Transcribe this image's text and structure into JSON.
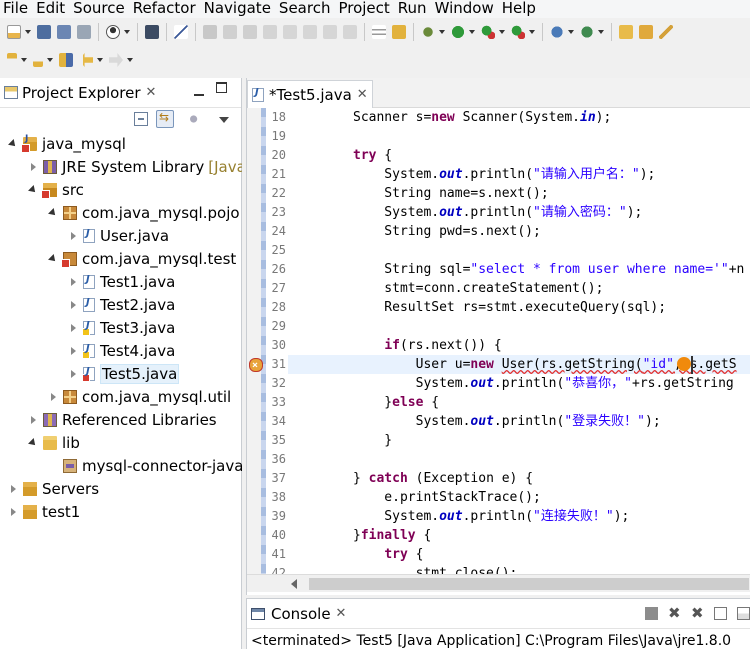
{
  "menu": [
    "File",
    "Edit",
    "Source",
    "Refactor",
    "Navigate",
    "Search",
    "Project",
    "Run",
    "Window",
    "Help"
  ],
  "explorer": {
    "title": "Project Explorer",
    "tree": [
      {
        "label": "java_mysql",
        "indent": 0,
        "state": "open",
        "icon": "project-error-icon",
        "name": "tree-project-java-mysql"
      },
      {
        "label": "JRE System Library",
        "suffix": "[Java",
        "indent": 1,
        "state": "closed",
        "icon": "library-icon",
        "name": "tree-jre-system-library"
      },
      {
        "label": "src",
        "indent": 1,
        "state": "open",
        "icon": "source-folder-error-icon",
        "name": "tree-src"
      },
      {
        "label": "com.java_mysql.pojo",
        "indent": 2,
        "state": "open",
        "icon": "package-icon",
        "name": "tree-package-pojo"
      },
      {
        "label": "User.java",
        "indent": 3,
        "state": "closed",
        "icon": "java-file-icon",
        "name": "tree-user-java"
      },
      {
        "label": "com.java_mysql.test",
        "indent": 2,
        "state": "open",
        "icon": "package-error-icon",
        "name": "tree-package-test"
      },
      {
        "label": "Test1.java",
        "indent": 3,
        "state": "closed",
        "icon": "java-file-icon",
        "name": "tree-test1-java"
      },
      {
        "label": "Test2.java",
        "indent": 3,
        "state": "closed",
        "icon": "java-file-icon",
        "name": "tree-test2-java"
      },
      {
        "label": "Test3.java",
        "indent": 3,
        "state": "closed",
        "icon": "java-file-warning-icon",
        "name": "tree-test3-java"
      },
      {
        "label": "Test4.java",
        "indent": 3,
        "state": "closed",
        "icon": "java-file-warning-icon",
        "name": "tree-test4-java"
      },
      {
        "label": "Test5.java",
        "indent": 3,
        "state": "closed",
        "icon": "java-file-error-icon",
        "name": "tree-test5-java",
        "selected": true
      },
      {
        "label": "com.java_mysql.util",
        "indent": 2,
        "state": "closed",
        "icon": "package-icon",
        "name": "tree-package-util"
      },
      {
        "label": "Referenced Libraries",
        "indent": 1,
        "state": "closed",
        "icon": "referenced-libraries-icon",
        "name": "tree-referenced-libraries"
      },
      {
        "label": "lib",
        "indent": 1,
        "state": "open",
        "icon": "folder-icon",
        "name": "tree-lib"
      },
      {
        "label": "mysql-connector-java",
        "indent": 2,
        "state": "none",
        "icon": "jar-file-icon",
        "name": "tree-mysql-connector"
      },
      {
        "label": "Servers",
        "indent": 0,
        "state": "closed",
        "icon": "project-icon",
        "name": "tree-servers"
      },
      {
        "label": "test1",
        "indent": 0,
        "state": "closed",
        "icon": "project-icon",
        "name": "tree-test1-project"
      }
    ]
  },
  "editor": {
    "tab_title": "*Test5.java",
    "current_line": 31,
    "error_line": 31,
    "lines": [
      {
        "no": "18",
        "tokens": [
          [
            "",
            "Scanner s="
          ],
          [
            "kw",
            "new"
          ],
          [
            "",
            " Scanner(System."
          ],
          [
            "fld",
            "in"
          ],
          [
            "",
            ");"
          ]
        ]
      },
      {
        "no": "19",
        "tokens": []
      },
      {
        "no": "20",
        "tokens": [
          [
            "kw",
            "try"
          ],
          [
            "",
            " {"
          ]
        ]
      },
      {
        "no": "21",
        "tokens": [
          [
            "",
            "    System."
          ],
          [
            "fld",
            "out"
          ],
          [
            "",
            ".println("
          ],
          [
            "str",
            "\"请输入用户名：\""
          ],
          [
            "",
            ");"
          ]
        ]
      },
      {
        "no": "22",
        "tokens": [
          [
            "",
            "    String name=s.next();"
          ]
        ]
      },
      {
        "no": "23",
        "tokens": [
          [
            "",
            "    System."
          ],
          [
            "fld",
            "out"
          ],
          [
            "",
            ".println("
          ],
          [
            "str",
            "\"请输入密码：\""
          ],
          [
            "",
            ");"
          ]
        ]
      },
      {
        "no": "24",
        "tokens": [
          [
            "",
            "    String pwd=s.next();"
          ]
        ]
      },
      {
        "no": "25",
        "tokens": []
      },
      {
        "no": "26",
        "tokens": [
          [
            "",
            "    String sql="
          ],
          [
            "str",
            "\"select * from user where name='\""
          ],
          [
            "",
            "+n"
          ]
        ]
      },
      {
        "no": "27",
        "tokens": [
          [
            "",
            "    stmt=conn.createStatement();"
          ]
        ]
      },
      {
        "no": "28",
        "tokens": [
          [
            "",
            "    ResultSet rs=stmt.executeQuery(sql);"
          ]
        ]
      },
      {
        "no": "29",
        "tokens": []
      },
      {
        "no": "30",
        "tokens": [
          [
            "",
            "    "
          ],
          [
            "kw",
            "if"
          ],
          [
            "",
            "(rs.next()) {"
          ]
        ]
      },
      {
        "no": "31",
        "tokens": [
          [
            "",
            "        User u="
          ],
          [
            "kw",
            "new"
          ],
          [
            "",
            " "
          ],
          [
            "err",
            "User(rs.getString("
          ],
          [
            "str err",
            "\"id\""
          ],
          [
            "err",
            ",rs.getS"
          ]
        ]
      },
      {
        "no": "32",
        "tokens": [
          [
            "",
            "        System."
          ],
          [
            "fld",
            "out"
          ],
          [
            "",
            ".println("
          ],
          [
            "str",
            "\"恭喜你，\""
          ],
          [
            "",
            "+rs.getString"
          ]
        ]
      },
      {
        "no": "33",
        "tokens": [
          [
            "",
            "    }"
          ],
          [
            "kw",
            "else"
          ],
          [
            "",
            " {"
          ]
        ]
      },
      {
        "no": "34",
        "tokens": [
          [
            "",
            "        System."
          ],
          [
            "fld",
            "out"
          ],
          [
            "",
            ".println("
          ],
          [
            "str",
            "\"登录失败！\""
          ],
          [
            "",
            ");"
          ]
        ]
      },
      {
        "no": "35",
        "tokens": [
          [
            "",
            "    }"
          ]
        ]
      },
      {
        "no": "36",
        "tokens": []
      },
      {
        "no": "37",
        "tokens": [
          [
            "",
            "} "
          ],
          [
            "kw",
            "catch"
          ],
          [
            "",
            " (Exception e) {"
          ]
        ]
      },
      {
        "no": "38",
        "tokens": [
          [
            "",
            "    e.printStackTrace();"
          ]
        ]
      },
      {
        "no": "39",
        "tokens": [
          [
            "",
            "    System."
          ],
          [
            "fld",
            "out"
          ],
          [
            "",
            ".println("
          ],
          [
            "str",
            "\"连接失败！\""
          ],
          [
            "",
            ");"
          ]
        ]
      },
      {
        "no": "40",
        "tokens": [
          [
            "",
            "}"
          ],
          [
            "kw",
            "finally"
          ],
          [
            "",
            " {"
          ]
        ]
      },
      {
        "no": "41",
        "tokens": [
          [
            "",
            "    "
          ],
          [
            "kw",
            "try"
          ],
          [
            "",
            " {"
          ]
        ]
      },
      {
        "no": "42",
        "tokens": [
          [
            "",
            "        stmt.close();"
          ]
        ]
      }
    ]
  },
  "console": {
    "title": "Console",
    "status": "<terminated> Test5 [Java Application] C:\\Program Files\\Java\\jre1.8.0"
  },
  "colors": {
    "keyword": "#7f0055",
    "string": "#2a00ff",
    "field": "#0000c0",
    "current_line_bg": "#e8f2fe",
    "selection_bg": "#e5f1fb"
  }
}
